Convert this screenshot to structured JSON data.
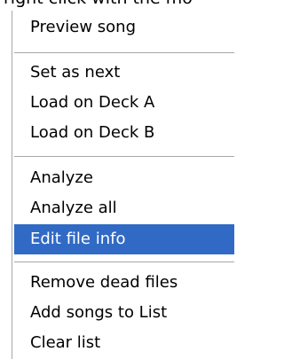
{
  "cut_text": "right click with the mo",
  "menu": {
    "items": [
      {
        "label": "Preview song"
      },
      {
        "label": "Set as next"
      },
      {
        "label": "Load on Deck A"
      },
      {
        "label": "Load on Deck B"
      },
      {
        "label": "Analyze"
      },
      {
        "label": "Analyze all"
      },
      {
        "label": "Edit file info",
        "selected": true
      },
      {
        "label": "Remove dead files"
      },
      {
        "label": "Add songs to List"
      },
      {
        "label": "Clear list"
      }
    ]
  },
  "colors": {
    "highlight": "#316ac5",
    "separator": "#a7a6aa"
  }
}
